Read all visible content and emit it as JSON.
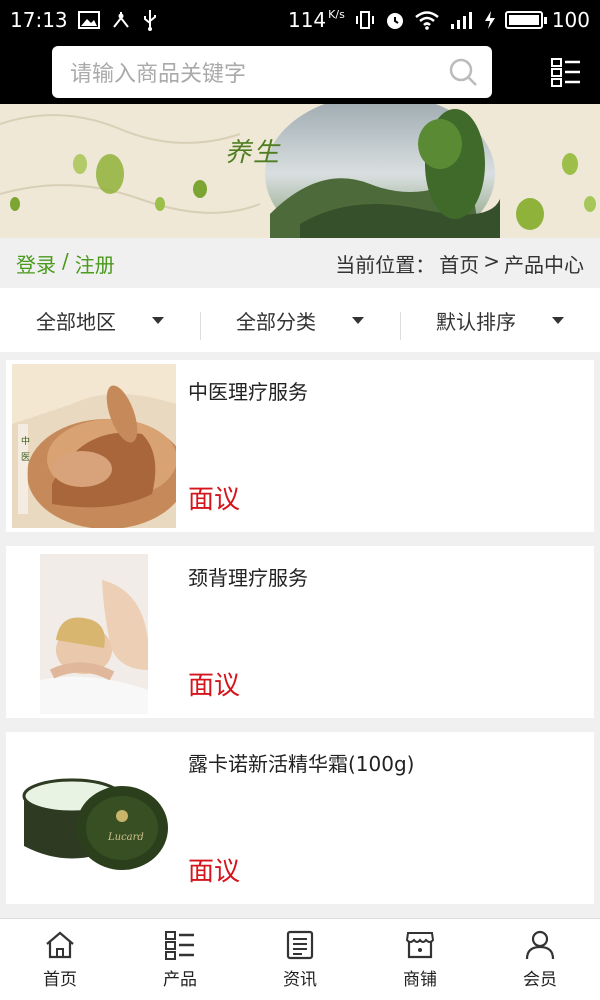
{
  "status_bar": {
    "time": "17:13",
    "speed": "114",
    "speed_unit": "K/s",
    "battery": "100"
  },
  "search": {
    "placeholder": "请输入商品关键字"
  },
  "banner": {
    "title": "养生"
  },
  "account": {
    "login": "登录",
    "separator": "/",
    "register": "注册"
  },
  "breadcrumb": {
    "label": "当前位置：",
    "home": "首页",
    "arrow": ">",
    "current": "产品中心"
  },
  "filters": {
    "region": "全部地区",
    "category": "全部分类",
    "sort": "默认排序"
  },
  "products": [
    {
      "name": "中医理疗服务",
      "price": "面议"
    },
    {
      "name": "颈背理疗服务",
      "price": "面议"
    },
    {
      "name": "露卡诺新活精华霜(100g)",
      "price": "面议"
    }
  ],
  "bottom_nav": [
    {
      "label": "首页",
      "icon": "home-icon"
    },
    {
      "label": "产品",
      "icon": "grid-list-icon"
    },
    {
      "label": "资讯",
      "icon": "news-icon"
    },
    {
      "label": "商铺",
      "icon": "store-icon"
    },
    {
      "label": "会员",
      "icon": "user-icon"
    }
  ],
  "colors": {
    "accent_green": "#4a9a1d",
    "price_red": "#d4161c",
    "header_bg": "#000000"
  }
}
